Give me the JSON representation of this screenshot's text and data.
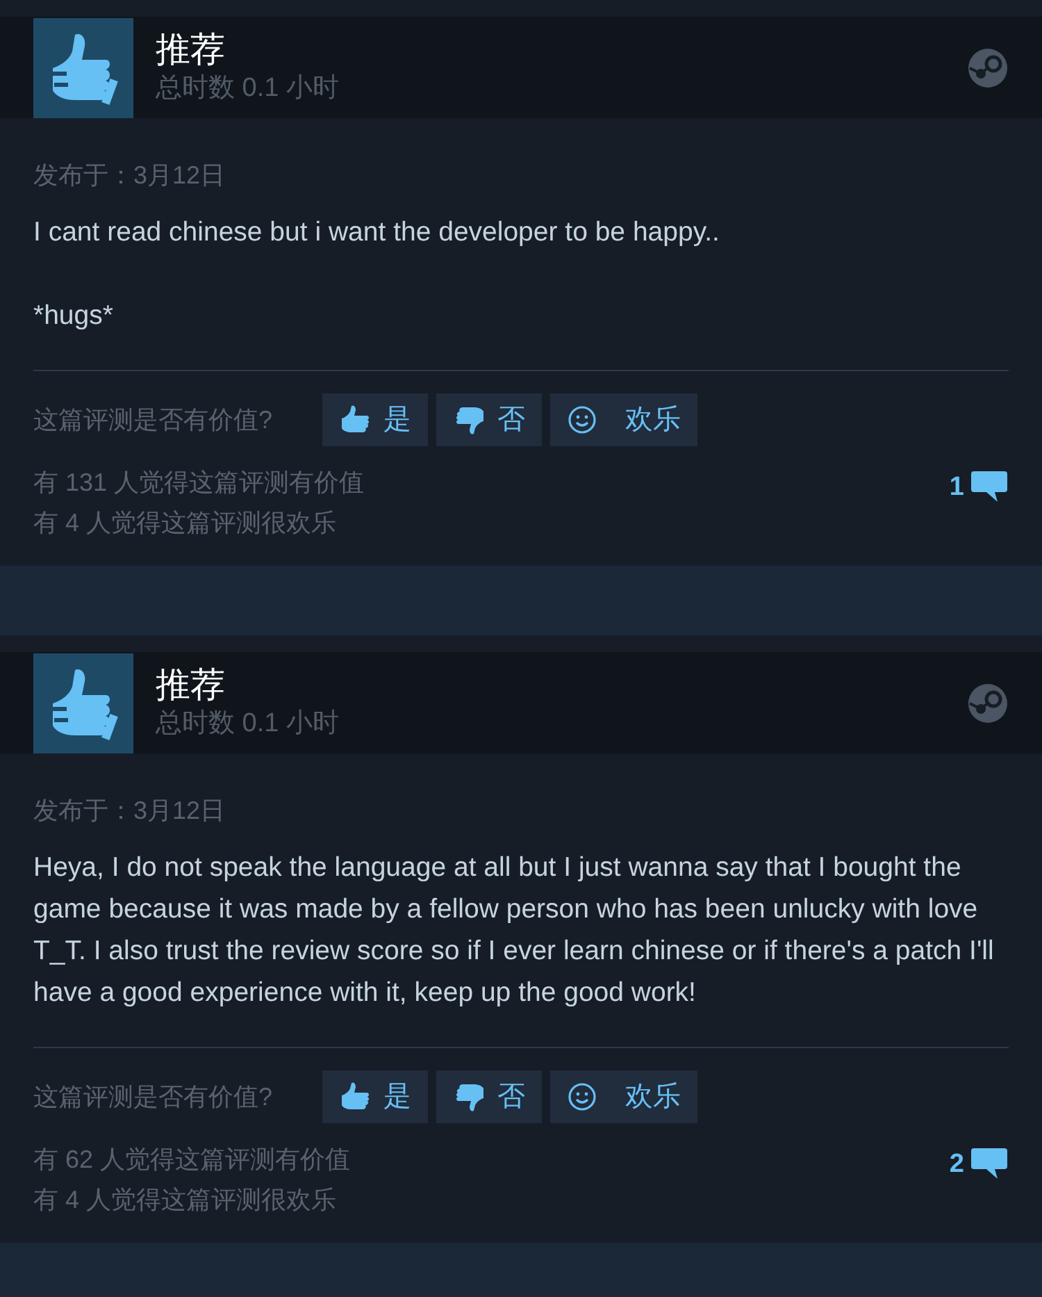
{
  "reviews": [
    {
      "verdict": "推荐",
      "hours": "总时数 0.1 小时",
      "posted": "发布于：3月12日",
      "paragraphs": [
        "I cant read chinese but i want the developer to be happy..",
        "*hugs*"
      ],
      "helpful_prompt": "这篇评测是否有价值?",
      "votes": [
        {
          "kind": "up",
          "label": "是"
        },
        {
          "kind": "down",
          "label": "否"
        },
        {
          "kind": "funny",
          "label": "欢乐"
        }
      ],
      "helpful_count": "有 131 人觉得这篇评测有价值",
      "funny_count": "有 4 人觉得这篇评测很欢乐",
      "comments": "1"
    },
    {
      "verdict": "推荐",
      "hours": "总时数 0.1 小时",
      "posted": "发布于：3月12日",
      "paragraphs": [
        "Heya, I do not speak the language at all but I just wanna say that I bought the game because it was made by a fellow person who has been unlucky with love T_T. I also trust the review score so if I ever learn chinese or if there's a patch I'll have a good experience with it, keep up the good work!"
      ],
      "helpful_prompt": "这篇评测是否有价值?",
      "votes": [
        {
          "kind": "up",
          "label": "是"
        },
        {
          "kind": "down",
          "label": "否"
        },
        {
          "kind": "funny",
          "label": "欢乐"
        }
      ],
      "helpful_count": "有 62 人觉得这篇评测有价值",
      "funny_count": "有 4 人觉得这篇评测很欢乐",
      "comments": "2"
    }
  ]
}
